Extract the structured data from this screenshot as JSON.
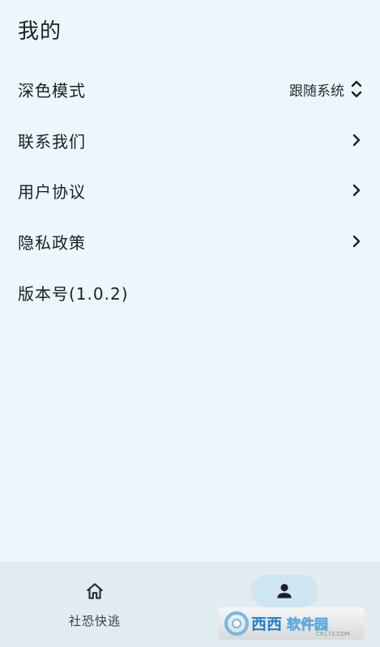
{
  "page": {
    "title": "我的"
  },
  "settings": [
    {
      "label": "深色模式",
      "value": "跟随系统",
      "control": "up-down-icon"
    },
    {
      "label": "联系我们",
      "control": "chevron-right-icon"
    },
    {
      "label": "用户协议",
      "control": "chevron-right-icon"
    },
    {
      "label": "隐私政策",
      "control": "chevron-right-icon"
    },
    {
      "label": "版本号(1.0.2)"
    }
  ],
  "bottom_nav": [
    {
      "label": "社恐快逃",
      "icon": "home-icon",
      "active": false
    },
    {
      "label": "",
      "icon": "person-icon",
      "active": true
    }
  ],
  "watermark": {
    "text": "西西软件园",
    "sub": "CR173.COM"
  },
  "colors": {
    "background": "#eef6fd",
    "nav_bar": "#e2ecf0",
    "active_pill": "#cfe5f2"
  }
}
